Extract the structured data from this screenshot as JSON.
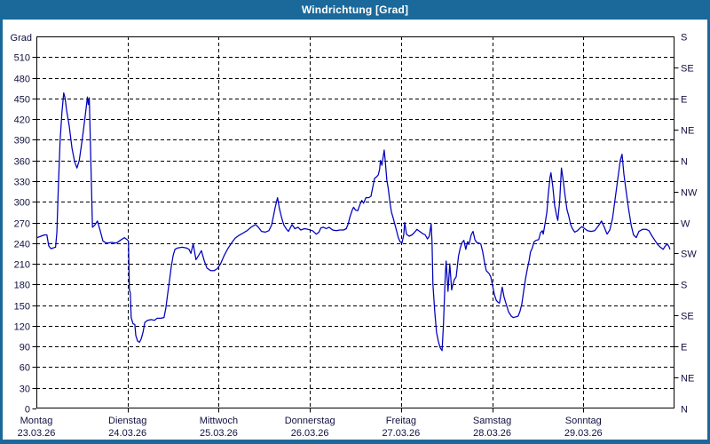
{
  "window": {
    "title": "Windrichtung [Grad]"
  },
  "colors": {
    "frame_blue": "#1b699b",
    "line_blue": "#0000bb",
    "grid_black": "#000000",
    "label_color": "#101040",
    "background": "#ffffff"
  },
  "chart_data": {
    "type": "line",
    "title": "Windrichtung [Grad]",
    "grid": {
      "horizontal_step_deg": 30,
      "vertical": "day-boundaries",
      "style": "dashed"
    },
    "legend_position": "none",
    "y_left": {
      "label": "Grad",
      "min": 0,
      "max": 540,
      "tick_step": 30,
      "ticks": [
        510,
        480,
        450,
        420,
        390,
        360,
        330,
        300,
        270,
        240,
        210,
        180,
        150,
        120,
        90,
        60,
        30,
        0
      ]
    },
    "y_right": {
      "ticks": [
        {
          "deg": 540,
          "label": "S"
        },
        {
          "deg": 495,
          "label": "SE"
        },
        {
          "deg": 450,
          "label": "E"
        },
        {
          "deg": 405,
          "label": "NE"
        },
        {
          "deg": 360,
          "label": "N"
        },
        {
          "deg": 315,
          "label": "NW"
        },
        {
          "deg": 270,
          "label": "W"
        },
        {
          "deg": 225,
          "label": "SW"
        },
        {
          "deg": 180,
          "label": "S"
        },
        {
          "deg": 135,
          "label": "SE"
        },
        {
          "deg": 90,
          "label": "E"
        },
        {
          "deg": 45,
          "label": "NE"
        },
        {
          "deg": 0,
          "label": "N"
        }
      ]
    },
    "x": {
      "days": [
        {
          "name": "Montag",
          "date": "23.03.26"
        },
        {
          "name": "Dienstag",
          "date": "24.03.26"
        },
        {
          "name": "Mittwoch",
          "date": "25.03.26"
        },
        {
          "name": "Donnerstag",
          "date": "26.03.26"
        },
        {
          "name": "Freitag",
          "date": "27.03.26"
        },
        {
          "name": "Samstag",
          "date": "28.03.26"
        },
        {
          "name": "Sonntag",
          "date": "29.03.26"
        }
      ]
    },
    "series": [
      {
        "name": "Windrichtung",
        "color": "#0000bb",
        "points": [
          [
            0.01,
            248
          ],
          [
            0.05,
            250
          ],
          [
            0.09,
            252
          ],
          [
            0.115,
            252
          ],
          [
            0.135,
            236
          ],
          [
            0.16,
            232
          ],
          [
            0.185,
            233
          ],
          [
            0.21,
            234
          ],
          [
            0.225,
            256
          ],
          [
            0.24,
            320
          ],
          [
            0.26,
            388
          ],
          [
            0.28,
            430
          ],
          [
            0.3,
            458
          ],
          [
            0.315,
            450
          ],
          [
            0.33,
            434
          ],
          [
            0.36,
            410
          ],
          [
            0.39,
            378
          ],
          [
            0.42,
            358
          ],
          [
            0.445,
            349
          ],
          [
            0.47,
            360
          ],
          [
            0.5,
            388
          ],
          [
            0.52,
            408
          ],
          [
            0.54,
            430
          ],
          [
            0.56,
            452
          ],
          [
            0.57,
            441
          ],
          [
            0.58,
            451
          ],
          [
            0.615,
            263
          ],
          [
            0.64,
            266
          ],
          [
            0.67,
            272
          ],
          [
            0.7,
            258
          ],
          [
            0.73,
            243
          ],
          [
            0.77,
            240
          ],
          [
            0.83,
            241
          ],
          [
            0.875,
            240
          ],
          [
            0.92,
            244
          ],
          [
            0.965,
            248
          ],
          [
            0.995,
            245
          ],
          [
            1.01,
            243
          ],
          [
            1.02,
            172
          ],
          [
            1.03,
            168
          ],
          [
            1.04,
            132
          ],
          [
            1.06,
            123
          ],
          [
            1.08,
            122
          ],
          [
            1.09,
            106
          ],
          [
            1.11,
            98
          ],
          [
            1.13,
            96
          ],
          [
            1.15,
            101
          ],
          [
            1.17,
            111
          ],
          [
            1.19,
            125
          ],
          [
            1.22,
            128
          ],
          [
            1.26,
            129
          ],
          [
            1.295,
            128
          ],
          [
            1.325,
            131
          ],
          [
            1.365,
            131
          ],
          [
            1.4,
            132
          ],
          [
            1.42,
            146
          ],
          [
            1.44,
            166
          ],
          [
            1.46,
            186
          ],
          [
            1.48,
            206
          ],
          [
            1.5,
            222
          ],
          [
            1.52,
            231
          ],
          [
            1.55,
            233
          ],
          [
            1.6,
            234
          ],
          [
            1.645,
            233
          ],
          [
            1.675,
            231
          ],
          [
            1.695,
            225
          ],
          [
            1.72,
            239
          ],
          [
            1.75,
            216
          ],
          [
            1.78,
            222
          ],
          [
            1.81,
            229
          ],
          [
            1.84,
            215
          ],
          [
            1.87,
            204
          ],
          [
            1.91,
            200
          ],
          [
            1.95,
            200
          ],
          [
            1.985,
            203
          ],
          [
            2.02,
            210
          ],
          [
            2.06,
            222
          ],
          [
            2.1,
            232
          ],
          [
            2.14,
            240
          ],
          [
            2.18,
            247
          ],
          [
            2.22,
            251
          ],
          [
            2.26,
            254
          ],
          [
            2.31,
            258
          ],
          [
            2.355,
            263
          ],
          [
            2.405,
            267
          ],
          [
            2.435,
            263
          ],
          [
            2.47,
            257
          ],
          [
            2.51,
            256
          ],
          [
            2.55,
            258
          ],
          [
            2.58,
            266
          ],
          [
            2.6,
            279
          ],
          [
            2.62,
            292
          ],
          [
            2.645,
            306
          ],
          [
            2.665,
            291
          ],
          [
            2.69,
            277
          ],
          [
            2.715,
            266
          ],
          [
            2.745,
            260
          ],
          [
            2.765,
            257
          ],
          [
            2.805,
            267
          ],
          [
            2.835,
            261
          ],
          [
            2.87,
            263
          ],
          [
            2.9,
            259
          ],
          [
            2.94,
            261
          ],
          [
            2.98,
            260
          ],
          [
            3.03,
            258
          ],
          [
            3.07,
            253
          ],
          [
            3.1,
            256
          ],
          [
            3.12,
            262
          ],
          [
            3.15,
            263
          ],
          [
            3.18,
            261
          ],
          [
            3.21,
            263
          ],
          [
            3.25,
            259
          ],
          [
            3.29,
            258
          ],
          [
            3.33,
            259
          ],
          [
            3.37,
            259
          ],
          [
            3.4,
            261
          ],
          [
            3.42,
            268
          ],
          [
            3.44,
            278
          ],
          [
            3.465,
            288
          ],
          [
            3.48,
            292
          ],
          [
            3.5,
            288
          ],
          [
            3.525,
            287
          ],
          [
            3.55,
            296
          ],
          [
            3.57,
            302
          ],
          [
            3.59,
            298
          ],
          [
            3.615,
            306
          ],
          [
            3.645,
            306
          ],
          [
            3.67,
            308
          ],
          [
            3.69,
            321
          ],
          [
            3.71,
            334
          ],
          [
            3.73,
            336
          ],
          [
            3.75,
            339
          ],
          [
            3.765,
            347
          ],
          [
            3.775,
            360
          ],
          [
            3.79,
            353
          ],
          [
            3.815,
            375
          ],
          [
            3.825,
            362
          ],
          [
            3.845,
            331
          ],
          [
            3.86,
            319
          ],
          [
            3.88,
            298
          ],
          [
            3.895,
            285
          ],
          [
            3.915,
            276
          ],
          [
            3.945,
            261
          ],
          [
            3.97,
            248
          ],
          [
            3.99,
            242
          ],
          [
            4.01,
            240
          ],
          [
            4.03,
            252
          ],
          [
            4.04,
            270
          ],
          [
            4.06,
            253
          ],
          [
            4.09,
            250
          ],
          [
            4.12,
            252
          ],
          [
            4.15,
            256
          ],
          [
            4.175,
            260
          ],
          [
            4.205,
            257
          ],
          [
            4.235,
            254
          ],
          [
            4.265,
            252
          ],
          [
            4.29,
            246
          ],
          [
            4.31,
            250
          ],
          [
            4.33,
            268
          ],
          [
            4.34,
            242
          ],
          [
            4.35,
            180
          ],
          [
            4.37,
            140
          ],
          [
            4.39,
            110
          ],
          [
            4.41,
            97
          ],
          [
            4.43,
            88
          ],
          [
            4.45,
            84
          ],
          [
            4.465,
            120
          ],
          [
            4.485,
            192
          ],
          [
            4.495,
            214
          ],
          [
            4.515,
            170
          ],
          [
            4.535,
            210
          ],
          [
            4.555,
            172
          ],
          [
            4.565,
            178
          ],
          [
            4.585,
            187
          ],
          [
            4.605,
            191
          ],
          [
            4.63,
            221
          ],
          [
            4.65,
            233
          ],
          [
            4.67,
            241
          ],
          [
            4.69,
            244
          ],
          [
            4.71,
            231
          ],
          [
            4.73,
            242
          ],
          [
            4.745,
            238
          ],
          [
            4.77,
            252
          ],
          [
            4.79,
            257
          ],
          [
            4.81,
            245
          ],
          [
            4.83,
            241
          ],
          [
            4.855,
            240
          ],
          [
            4.875,
            239
          ],
          [
            4.895,
            228
          ],
          [
            4.915,
            213
          ],
          [
            4.935,
            200
          ],
          [
            4.965,
            196
          ],
          [
            4.985,
            191
          ],
          [
            5.005,
            178
          ],
          [
            5.025,
            165
          ],
          [
            5.045,
            157
          ],
          [
            5.065,
            154
          ],
          [
            5.08,
            153
          ],
          [
            5.1,
            168
          ],
          [
            5.11,
            176
          ],
          [
            5.13,
            162
          ],
          [
            5.15,
            153
          ],
          [
            5.18,
            140
          ],
          [
            5.21,
            134
          ],
          [
            5.23,
            132
          ],
          [
            5.26,
            133
          ],
          [
            5.285,
            134
          ],
          [
            5.305,
            141
          ],
          [
            5.325,
            152
          ],
          [
            5.345,
            170
          ],
          [
            5.365,
            188
          ],
          [
            5.385,
            202
          ],
          [
            5.405,
            215
          ],
          [
            5.42,
            227
          ],
          [
            5.44,
            233
          ],
          [
            5.46,
            242
          ],
          [
            5.48,
            244
          ],
          [
            5.51,
            245
          ],
          [
            5.53,
            255
          ],
          [
            5.55,
            258
          ],
          [
            5.56,
            253
          ],
          [
            5.58,
            268
          ],
          [
            5.6,
            285
          ],
          [
            5.615,
            310
          ],
          [
            5.635,
            336
          ],
          [
            5.645,
            342
          ],
          [
            5.665,
            322
          ],
          [
            5.685,
            295
          ],
          [
            5.705,
            281
          ],
          [
            5.72,
            273
          ],
          [
            5.74,
            300
          ],
          [
            5.76,
            349
          ],
          [
            5.78,
            330
          ],
          [
            5.8,
            309
          ],
          [
            5.82,
            289
          ],
          [
            5.84,
            279
          ],
          [
            5.86,
            267
          ],
          [
            5.88,
            261
          ],
          [
            5.905,
            256
          ],
          [
            5.935,
            258
          ],
          [
            5.965,
            262
          ],
          [
            5.985,
            264
          ],
          [
            6.015,
            261
          ],
          [
            6.045,
            258
          ],
          [
            6.085,
            257
          ],
          [
            6.125,
            258
          ],
          [
            6.165,
            265
          ],
          [
            6.2,
            272
          ],
          [
            6.23,
            263
          ],
          [
            6.26,
            253
          ],
          [
            6.29,
            259
          ],
          [
            6.32,
            276
          ],
          [
            6.35,
            305
          ],
          [
            6.38,
            335
          ],
          [
            6.405,
            360
          ],
          [
            6.425,
            369
          ],
          [
            6.445,
            340
          ],
          [
            6.465,
            320
          ],
          [
            6.495,
            291
          ],
          [
            6.525,
            266
          ],
          [
            6.55,
            252
          ],
          [
            6.58,
            248
          ],
          [
            6.61,
            257
          ],
          [
            6.65,
            260
          ],
          [
            6.69,
            260
          ],
          [
            6.72,
            258
          ],
          [
            6.755,
            250
          ],
          [
            6.785,
            244
          ],
          [
            6.815,
            238
          ],
          [
            6.845,
            234
          ],
          [
            6.875,
            231
          ],
          [
            6.895,
            235
          ],
          [
            6.92,
            239
          ],
          [
            6.94,
            235
          ],
          [
            6.95,
            231
          ]
        ]
      }
    ]
  }
}
